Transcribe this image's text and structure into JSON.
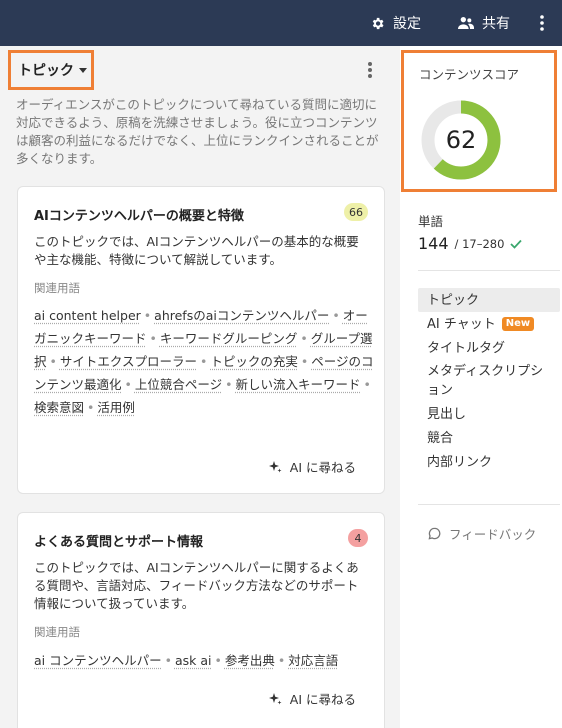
{
  "topbar": {
    "settings_label": "設定",
    "share_label": "共有"
  },
  "topic": {
    "dropdown_label": "トピック",
    "intro": "オーディエンスがこのトピックについて尋ねている質問に適切に対応できるよう、原稿を洗練させましょう。役に立つコンテンツは顧客の利益になるだけでなく、上位にランクインされることが多くなります。"
  },
  "cards": [
    {
      "title": "AIコンテンツヘルパーの概要と特徴",
      "badge": "66",
      "description": "このトピックでは、AIコンテンツヘルパーの基本的な概要や主な機能、特徴について解説しています。",
      "related_label": "関連用語",
      "terms": [
        "ai content helper",
        "ahrefsのaiコンテンツヘルパー",
        "オーガニックキーワード",
        "キーワードグルーピング",
        "グループ選択",
        "サイトエクスプローラー",
        "トピックの充実",
        "ページのコンテンツ最適化",
        "上位競合ページ",
        "新しい流入キーワード",
        "検索意図",
        "活用例"
      ],
      "ask_label": "AI に尋ねる"
    },
    {
      "title": "よくある質問とサポート情報",
      "badge": "4",
      "description": "このトピックでは、AIコンテンツヘルパーに関するよくある質問や、言語対応、フィードバック方法などのサポート情報について扱っています。",
      "related_label": "関連用語",
      "terms": [
        "ai コンテンツヘルパー",
        "ask ai",
        "参考出典",
        "対応言語"
      ],
      "ask_label": "AI に尋ねる"
    }
  ],
  "score": {
    "label": "コンテンツスコア",
    "value": 62,
    "max": 100,
    "color": "#8dc13f",
    "track_color": "#e8e8e8"
  },
  "words": {
    "label": "単語",
    "count": "144",
    "range": "/ 17–280"
  },
  "nav": {
    "items": [
      {
        "label": "トピック",
        "active": true
      },
      {
        "label": "AI チャット",
        "badge": "New"
      },
      {
        "label": "タイトルタグ"
      },
      {
        "label": "メタディスクリプション"
      },
      {
        "label": "見出し"
      },
      {
        "label": "競合"
      },
      {
        "label": "内部リンク"
      }
    ]
  },
  "feedback_label": "フィードバック"
}
